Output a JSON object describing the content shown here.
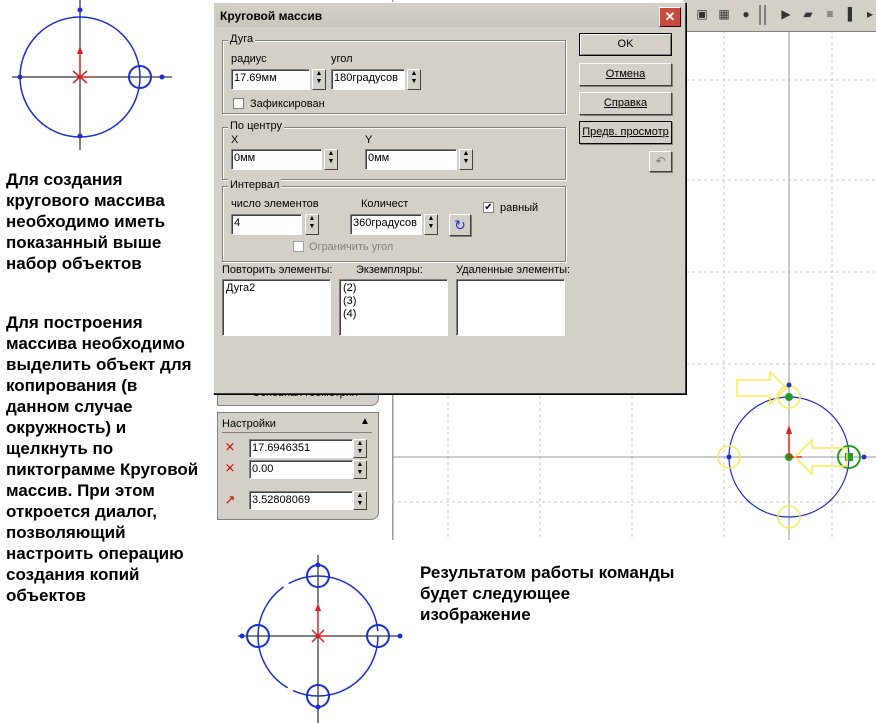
{
  "notes": {
    "left": "Для создания кругового массива необходимо иметь показанный выше набор объектов",
    "left2": "Для построения массива необходимо выделить объект для копирования (в данном случае окружность) и щелкнуть по пиктограмме Круговой массив. При этом откроется диалог, позволяющий настроить операцию создания копий объектов",
    "bottom_right": "Результатом работы команды будет следующее изображение"
  },
  "dialog": {
    "title": "Круговой массив",
    "arc": {
      "legend": "Дуга",
      "radius_label": "радиус",
      "radius_value": "17.69мм",
      "angle_label": "угол",
      "angle_value": "180градусов",
      "fixed_label": "Зафиксирован",
      "fixed_checked": false
    },
    "center": {
      "legend": "По центру",
      "x_label": "X",
      "x_value": "0мм",
      "y_label": "Y",
      "y_value": "0мм"
    },
    "interval": {
      "legend": "Интервал",
      "count_label": "число элементов",
      "count_value": "4",
      "quantity_label": "Количест",
      "quantity_value": "360градусов",
      "equal_label": "равный",
      "equal_checked": true,
      "limit_label": "Ограничить угол"
    },
    "lists": {
      "repeat_label": "Повторить элементы:",
      "repeat_items": [
        "Дуга2"
      ],
      "instances_label": "Экземпляры:",
      "instances_items": [
        "(2)",
        "(3)",
        "(4)"
      ],
      "removed_label": "Удаленные элементы:"
    },
    "buttons": {
      "ok": "OK",
      "cancel": "Отмена",
      "help": "Справка",
      "preview": "Предв. просмотр"
    }
  },
  "settings": {
    "hidden_label": "Основная геометрия",
    "title": "Настройки",
    "values": [
      "17.6946351",
      "0.00",
      "3.52808069"
    ]
  },
  "colors": {
    "circle": "#1a2fd0",
    "axis": "#000000",
    "highlight": "#ffe94d",
    "select": "#1fa01f",
    "arrow": "#e02020"
  }
}
